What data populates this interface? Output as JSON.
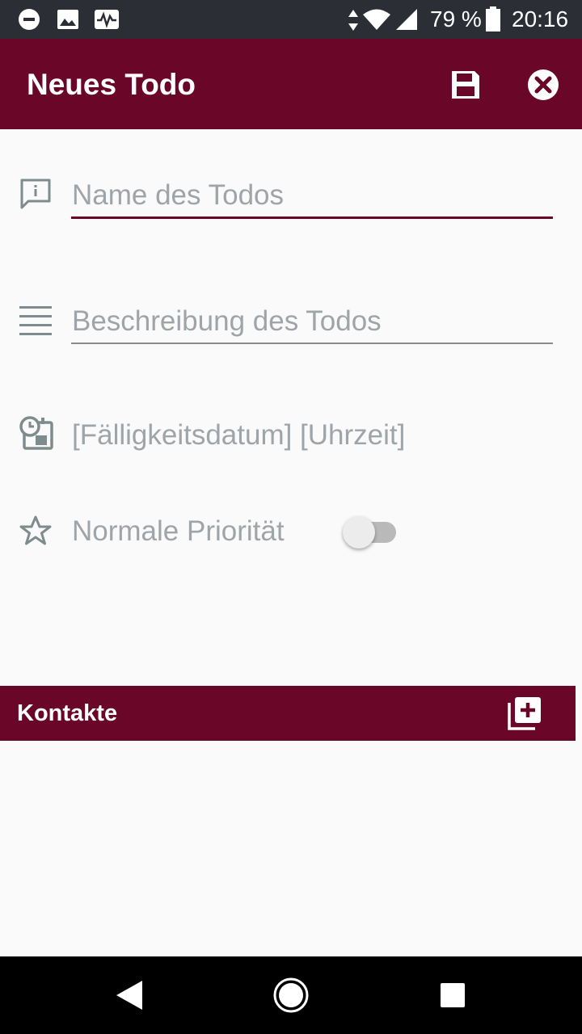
{
  "status_bar": {
    "battery": "79 %",
    "time": "20:16",
    "icons": [
      "do-not-disturb-icon",
      "image-icon",
      "activity-icon",
      "data-arrows-icon",
      "wifi-icon",
      "signal-icon",
      "battery-icon"
    ]
  },
  "app_bar": {
    "title": "Neues Todo",
    "actions": [
      "save-icon",
      "close-icon"
    ]
  },
  "form": {
    "name_placeholder": "Name des Todos",
    "description_placeholder": "Beschreibung des Todos",
    "due_date_text": "[Fälligkeitsdatum] [Uhrzeit]",
    "priority_label": "Normale Priorität",
    "priority_on": false
  },
  "contacts": {
    "title": "Kontakte",
    "add_icon": "add-contact-icon"
  },
  "nav_bar": {
    "icons": [
      "back-icon",
      "home-icon",
      "recents-icon"
    ]
  },
  "colors": {
    "primary": "#6a0728",
    "status_bar": "#2b2f35",
    "background": "#fafafa",
    "hint_text": "#9ea4a8"
  }
}
